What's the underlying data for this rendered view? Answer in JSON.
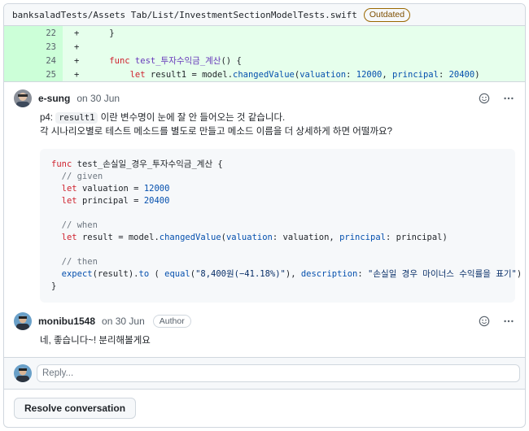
{
  "file": {
    "path": "banksaladTests/Assets Tab/List/InvestmentSectionModelTests.swift",
    "badge": "Outdated"
  },
  "diff": [
    {
      "num": "22",
      "sign": "+",
      "code": "    }"
    },
    {
      "num": "23",
      "sign": "+",
      "code": ""
    },
    {
      "num": "24",
      "sign": "+",
      "code_kw": "func",
      "code_fn": "test_투자수익금_계산",
      "code_rest": "() {"
    },
    {
      "num": "25",
      "sign": "+",
      "code_kw": "let",
      "code_lead": "        ",
      "code_var": " result1 = model.",
      "code_call": "changedValue",
      "code_p1": "(",
      "code_arg1": "valuation",
      "code_c1": ": ",
      "code_n1": "12000",
      "code_c2": ", ",
      "code_arg2": "principal",
      "code_c3": ": ",
      "code_n2": "20400",
      "code_end": ")"
    }
  ],
  "comments": [
    {
      "author": "e-sung",
      "date": "on 30 Jun",
      "line1_pre": "p4: ",
      "line1_code": "result1",
      "line1_post": " 이란 변수명이 눈에 잘 안 들어오는 것 같습니다.",
      "line2": "각 시나리오별로 테스트 메소드를 별도로 만들고 메소드 이름을 더 상세하게 하면 어떨까요?",
      "code": {
        "l1_kw": "func",
        "l1_rest": " test_손실일_경우_투자수익금_계산 {",
        "l2": "  // given",
        "l3_kw": "let",
        "l3_rest": " valuation = ",
        "l3_num": "12000",
        "l4_kw": "let",
        "l4_rest": " principal = ",
        "l4_num": "20400",
        "l5": "  // when",
        "l6_kw": "let",
        "l6_a": " result = model.",
        "l6_call": "changedValue",
        "l6_b": "(",
        "l6_arg1": "valuation",
        "l6_c": ": valuation, ",
        "l6_arg2": "principal",
        "l6_d": ": principal)",
        "l7": "  // then",
        "l8_call": "expect",
        "l8_a": "(result).",
        "l8_to": "to",
        "l8_b": " ( ",
        "l8_equal": "equal",
        "l8_c": "(",
        "l8_str1": "\"8,400원(−41.18%)\"",
        "l8_d": "), ",
        "l8_desc": "description",
        "l8_e": ": ",
        "l8_str2": "\"손실일 경우 마이너스 수익률을 표기\"",
        "l8_f": ")",
        "l9": "}"
      }
    },
    {
      "author": "monibu1548",
      "date": "on 30 Jun",
      "badge": "Author",
      "text": "네, 좋습니다~! 분리해볼게요"
    }
  ],
  "reply": {
    "placeholder": "Reply..."
  },
  "resolve_label": "Resolve conversation"
}
